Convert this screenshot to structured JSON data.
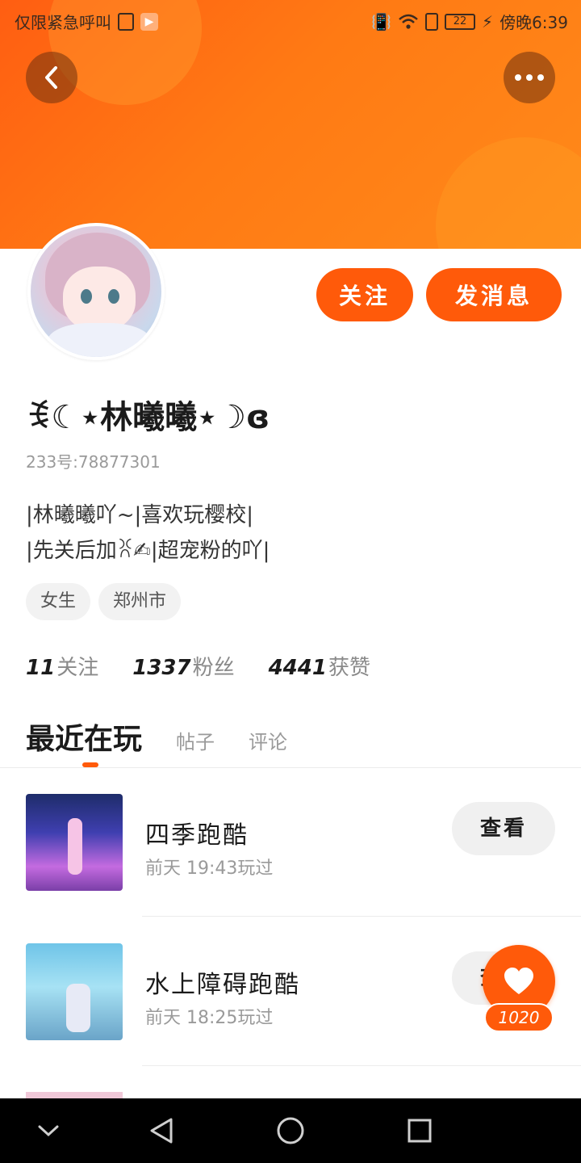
{
  "status_bar": {
    "carrier": "仅限紧急呼叫",
    "battery": "22",
    "time": "傍晚6:39"
  },
  "icons": {
    "back": "chevron-left-icon",
    "more": "more-dots-icon",
    "like": "heart-icon"
  },
  "colors": {
    "accent": "#ff5a0a",
    "header_gradient_start": "#ff5e12",
    "header_gradient_end": "#ff8a1a"
  },
  "profile": {
    "nickname": "ꉂ☾⋆林曦曦⋆☽ɞ",
    "user_id": "233号:78877301",
    "bio_line1": "|林曦曦吖~|喜欢玩樱校|",
    "bio_line2": "|先关后加ꐦ✍|超宠粉的吖|",
    "tags": [
      "女生",
      "郑州市"
    ]
  },
  "actions": {
    "follow": "关注",
    "message": "发消息"
  },
  "stats": {
    "following_num": "11",
    "following_label": "关注",
    "fans_num": "1337",
    "fans_label": "粉丝",
    "likes_num": "4441",
    "likes_label": "获赞"
  },
  "tabs": {
    "recent": "最近在玩",
    "posts": "帖子",
    "comments": "评论"
  },
  "games": [
    {
      "title": "四季跑酷",
      "time": "前天 19:43玩过",
      "button": "查看"
    },
    {
      "title": "水上障碍跑酷",
      "time": "前天 18:25玩过",
      "button": "查看"
    }
  ],
  "like_fab": {
    "count": "1020"
  }
}
